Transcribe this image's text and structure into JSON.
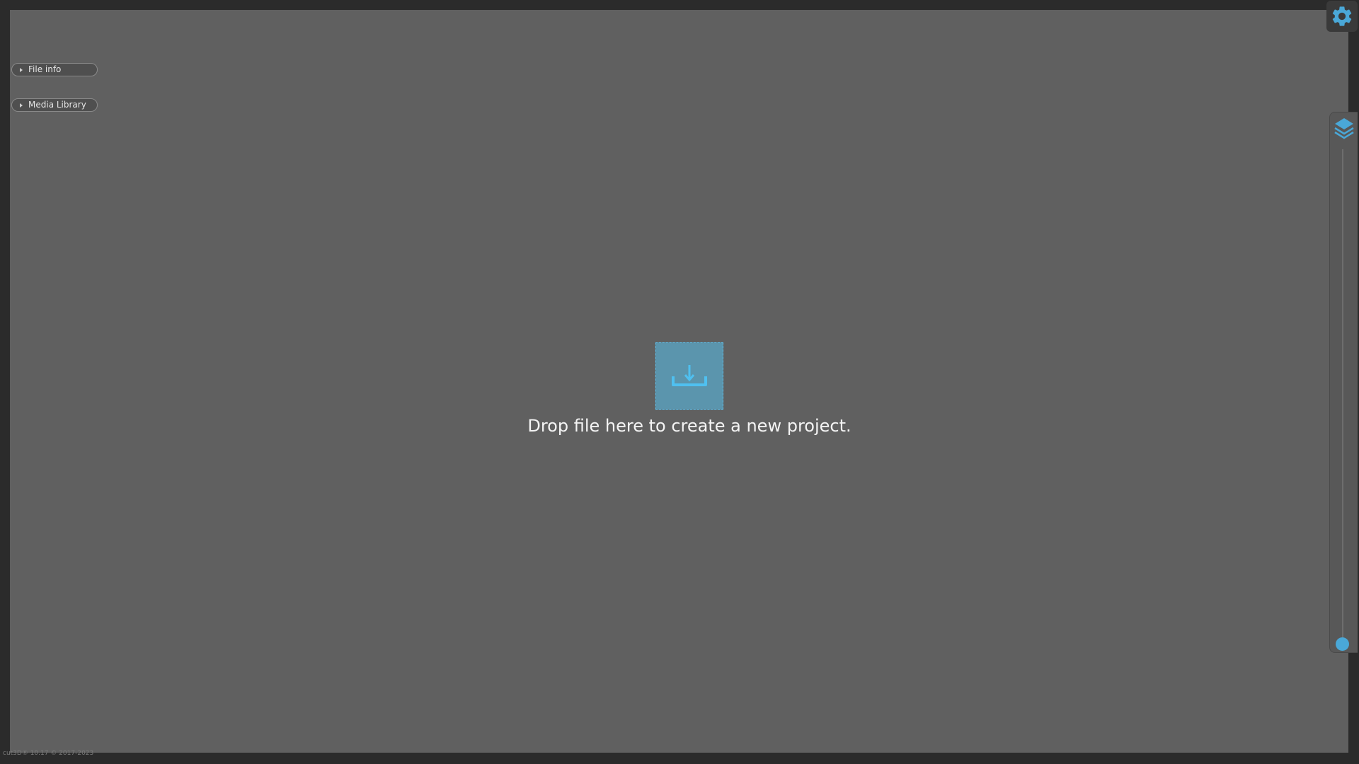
{
  "panels": {
    "file_info_label": "File info",
    "media_library_label": "Media Library"
  },
  "drop_zone": {
    "message": "Drop file here to create a new project.",
    "icon": "download-tray-icon"
  },
  "toolbar": {
    "settings_icon": "gear-icon",
    "layers_icon": "layers-icon"
  },
  "footer": {
    "text": "cut3D® 10.17 © 2017-2023"
  },
  "colors": {
    "accent": "#4aa8d8",
    "drop_zone_fill": "#5b95ad",
    "drop_zone_border": "#5ec3f0",
    "canvas": "#606060",
    "frame": "#2b2b2b"
  }
}
